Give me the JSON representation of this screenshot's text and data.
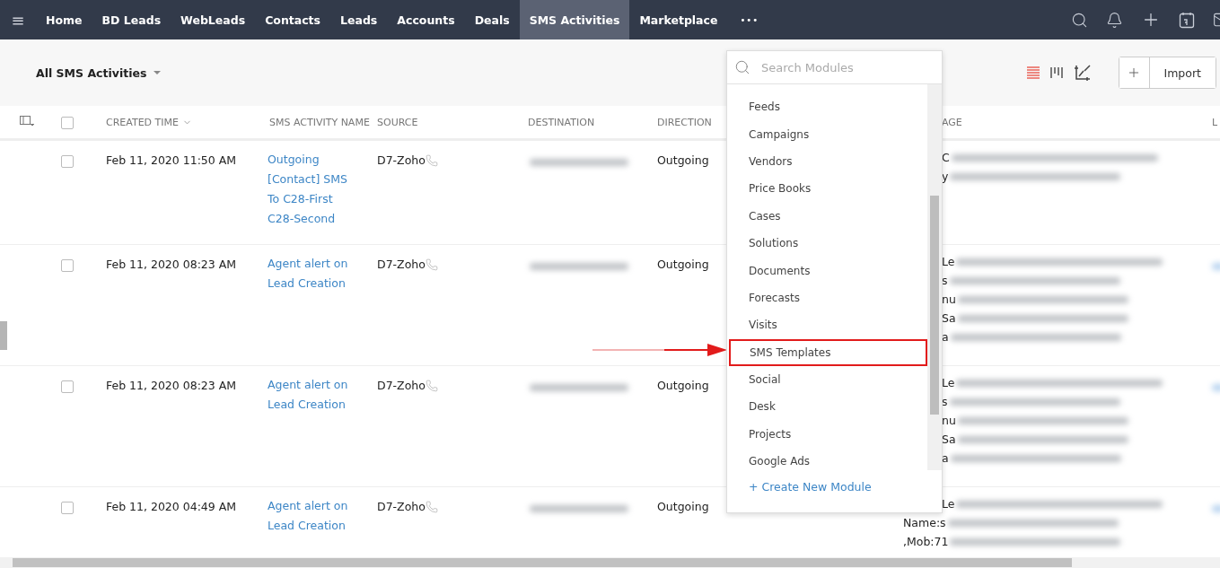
{
  "nav": {
    "menu_icon": "≡",
    "tabs": [
      {
        "label": "Home",
        "selected": false
      },
      {
        "label": "BD Leads",
        "selected": false
      },
      {
        "label": "WebLeads",
        "selected": false
      },
      {
        "label": "Contacts",
        "selected": false
      },
      {
        "label": "Leads",
        "selected": false
      },
      {
        "label": "Accounts",
        "selected": false
      },
      {
        "label": "Deals",
        "selected": false
      },
      {
        "label": "SMS Activities",
        "selected": true
      },
      {
        "label": "Marketplace",
        "selected": false
      }
    ],
    "more": "•••"
  },
  "toolbar": {
    "view": "All SMS Activities",
    "views": [
      {
        "kind": "list",
        "selected": true
      },
      {
        "kind": "kanban",
        "selected": false
      },
      {
        "kind": "chart",
        "selected": false
      }
    ],
    "import": "Import"
  },
  "table": {
    "all_checked": false,
    "columns": [
      "CREATED TIME",
      "SMS ACTIVITY NAME",
      "SOURCE",
      "DESTINATION",
      "DIRECTION",
      "AGE",
      "L"
    ],
    "rows": [
      {
        "checked": false,
        "created": "Feb 11, 2020 11:50 AM",
        "name": "Outgoing [Contact] SMS To C28-First C28-Second",
        "source": "D7-Zoho",
        "direction": "Outgoing",
        "message": [
          {
            "kind": "covered",
            "text": "C"
          },
          {
            "kind": "covered",
            "text": "y"
          }
        ]
      },
      {
        "checked": false,
        "created": "Feb 11, 2020 08:23 AM",
        "name": "Agent alert on Lead Creation",
        "source": "D7-Zoho",
        "direction": "Outgoing",
        "message": [
          {
            "kind": "covered",
            "text": "Le"
          },
          {
            "kind": "covered",
            "text": "s"
          },
          {
            "kind": "covered",
            "text": "nu"
          },
          {
            "kind": "covered",
            "text": "Sa"
          },
          {
            "kind": "covered",
            "text": "a"
          }
        ]
      },
      {
        "checked": false,
        "created": "Feb 11, 2020 08:23 AM",
        "name": "Agent alert on Lead Creation",
        "source": "D7-Zoho",
        "direction": "Outgoing",
        "message": [
          {
            "kind": "covered",
            "text": "Le"
          },
          {
            "kind": "covered",
            "text": "s"
          },
          {
            "kind": "covered",
            "text": "nu"
          },
          {
            "kind": "covered",
            "text": "Sa"
          },
          {
            "kind": "covered",
            "text": "a"
          }
        ]
      },
      {
        "checked": false,
        "created": "Feb 11, 2020 04:49 AM",
        "name": "Agent alert on Lead Creation",
        "source": "D7-Zoho",
        "direction": "Outgoing",
        "message": [
          {
            "kind": "covered",
            "text": "Le"
          },
          {
            "kind": "open",
            "text": "Name:s"
          },
          {
            "kind": "open",
            "text": ",Mob:71"
          }
        ]
      }
    ]
  },
  "modules_menu": {
    "placeholder": "Search Modules",
    "items": [
      {
        "label": "Feeds",
        "highlighted": false
      },
      {
        "label": "Campaigns",
        "highlighted": false
      },
      {
        "label": "Vendors",
        "highlighted": false
      },
      {
        "label": "Price Books",
        "highlighted": false
      },
      {
        "label": "Cases",
        "highlighted": false
      },
      {
        "label": "Solutions",
        "highlighted": false
      },
      {
        "label": "Documents",
        "highlighted": false
      },
      {
        "label": "Forecasts",
        "highlighted": false
      },
      {
        "label": "Visits",
        "highlighted": false
      },
      {
        "label": "SMS Templates",
        "highlighted": true
      },
      {
        "label": "Social",
        "highlighted": false
      },
      {
        "label": "Desk",
        "highlighted": false
      },
      {
        "label": "Projects",
        "highlighted": false
      },
      {
        "label": "Google Ads",
        "highlighted": false
      }
    ],
    "create": "+ Create New Module"
  }
}
